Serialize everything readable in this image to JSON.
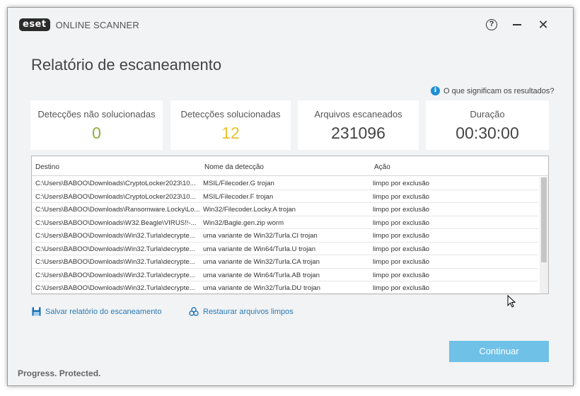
{
  "app": {
    "logo_badge": "eset",
    "logo_text": "ONLINE SCANNER"
  },
  "titlebar": {
    "help_glyph": "?",
    "close_glyph": "✕"
  },
  "page": {
    "title": "Relatório de escaneamento"
  },
  "results_help": {
    "icon_glyph": "i",
    "label": "O que significam os resultados?"
  },
  "stats": [
    {
      "label": "Detecções não solucionadas",
      "value": "0",
      "color": "#8bb03a"
    },
    {
      "label": "Detecções solucionadas",
      "value": "12",
      "color": "#e6c330"
    },
    {
      "label": "Arquivos escaneados",
      "value": "231096",
      "color": "#444444"
    },
    {
      "label": "Duração",
      "value": "00:30:00",
      "color": "#444444"
    }
  ],
  "table": {
    "headers": [
      "Destino",
      "Nome da detecção",
      "Ação"
    ],
    "rows": [
      [
        "C:\\Users\\BABOO\\Downloads\\CryptoLocker2023\\10...",
        "MSIL/Filecoder.G trojan",
        "limpo por exclusão"
      ],
      [
        "C:\\Users\\BABOO\\Downloads\\CryptoLocker2023\\10...",
        "MSIL/Filecoder.F trojan",
        "limpo por exclusão"
      ],
      [
        "C:\\Users\\BABOO\\Downloads\\Ransomware.Locky\\Lo...",
        "Win32/Filecoder.Locky.A trojan",
        "limpo por exclusão"
      ],
      [
        "C:\\Users\\BABOO\\Downloads\\W32.Beagle\\VIRUS!!-...",
        "Win32/Bagle.gen.zip worm",
        "limpo por exclusão"
      ],
      [
        "C:\\Users\\BABOO\\Downloads\\Win32.Turla\\decrypte...",
        "uma variante de Win32/Turla.CI trojan",
        "limpo por exclusão"
      ],
      [
        "C:\\Users\\BABOO\\Downloads\\Win32.Turla\\decrypte...",
        "uma variante de Win64/Turla.U trojan",
        "limpo por exclusão"
      ],
      [
        "C:\\Users\\BABOO\\Downloads\\Win32.Turla\\decrypte...",
        "uma variante de Win32/Turla.CA trojan",
        "limpo por exclusão"
      ],
      [
        "C:\\Users\\BABOO\\Downloads\\Win32.Turla\\decrypte...",
        "uma variante de Win64/Turla.AB trojan",
        "limpo por exclusão"
      ],
      [
        "C:\\Users\\BABOO\\Downloads\\Win32.Turla\\decrypte...",
        "uma variante de Win32/Turla.DU trojan",
        "limpo por exclusão"
      ]
    ]
  },
  "actions": {
    "save_report": "Salvar relatório do escaneamento",
    "restore_files": "Restaurar arquivos limpos",
    "continue": "Continuar"
  },
  "footer": {
    "tagline": "Progress. Protected."
  },
  "icons": {
    "save": "save-icon",
    "restore": "biohazard-icon",
    "info": "info-icon"
  },
  "colors": {
    "accent": "#1d8ed6",
    "continue_button": "#6fc1e8",
    "link": "#2a7ab5"
  }
}
